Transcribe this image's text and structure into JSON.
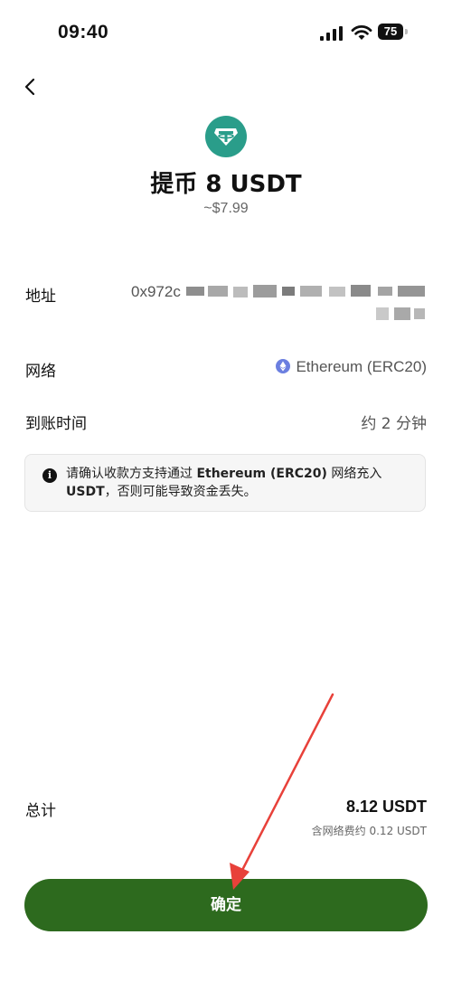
{
  "status_bar": {
    "time": "09:40",
    "battery": "75"
  },
  "header": {
    "title": "提币 8 USDT",
    "subtitle": "~$7.99"
  },
  "rows": {
    "address": {
      "label": "地址",
      "value_prefix": "0x972c"
    },
    "network": {
      "label": "网络",
      "value": "Ethereum (ERC20)"
    },
    "arrival": {
      "label": "到账时间",
      "value": "约 2 分钟"
    }
  },
  "notice": {
    "text_1": "请确认收款方支持通过 ",
    "network": "Ethereum (ERC20)",
    "text_2": " 网络充入 ",
    "token": "USDT",
    "text_3": "，否则可能导致资金丢失。"
  },
  "total": {
    "label": "总计",
    "value": "8.12 USDT",
    "fee": "含网络费约 0.12 USDT"
  },
  "confirm_button": {
    "label": "确定"
  },
  "colors": {
    "accent": "#2d6a1e",
    "coin": "#2a9d8a",
    "eth": "#6b7fe0",
    "annotation_arrow": "#e8413a"
  },
  "icons": {
    "back": "chevron-left-icon",
    "coin": "tether-icon",
    "network": "ethereum-icon",
    "info": "info-icon"
  }
}
